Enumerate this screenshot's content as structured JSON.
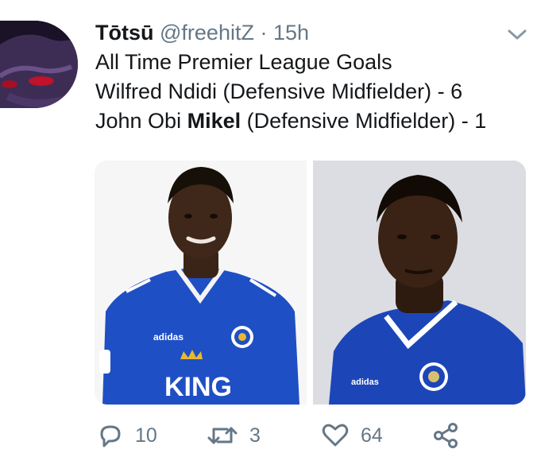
{
  "tweet": {
    "display_name": "Tōtsū",
    "handle": "@freehitZ",
    "separator": "·",
    "time": "15h",
    "lines": [
      "All Time Premier League Goals",
      "Wilfred Ndidi (Defensive Midfielder) - 6"
    ],
    "line3_prefix": "John Obi ",
    "line3_bold": "Mikel",
    "line3_suffix": " (Defensive Midfielder) - 1"
  },
  "media": {
    "left_shirt_sponsor": "KING",
    "left_kit_brand": "adidas",
    "right_kit_brand": "adidas"
  },
  "actions": {
    "reply_count": "10",
    "retweet_count": "3",
    "like_count": "64"
  },
  "icons": {
    "chevron": "chevron-down-icon",
    "reply": "reply-icon",
    "retweet": "retweet-icon",
    "like": "heart-icon",
    "share": "share-icon"
  },
  "colors": {
    "text": "#14171a",
    "secondary": "#657786",
    "leicester_blue": "#1f4fc4",
    "chelsea_blue": "#1c46b8"
  }
}
